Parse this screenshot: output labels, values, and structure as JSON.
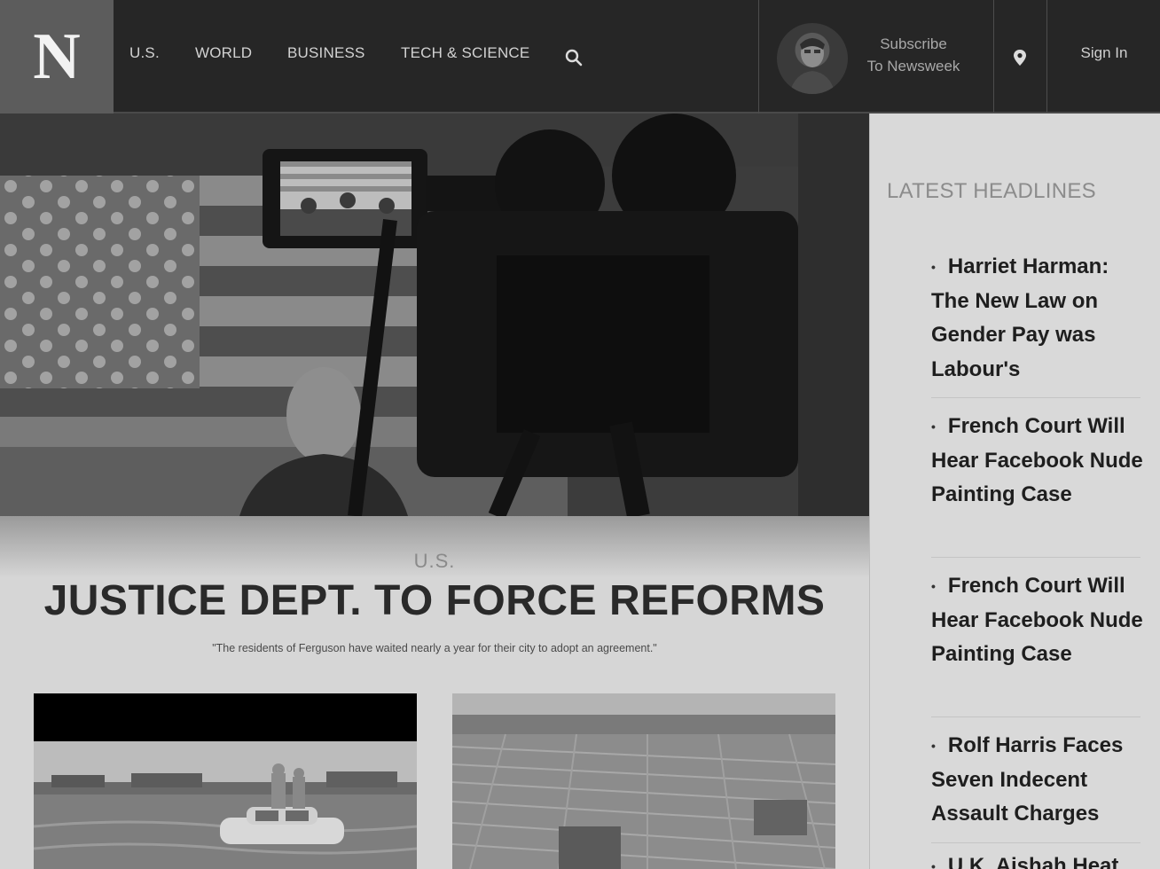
{
  "header": {
    "logo": "N",
    "nav": [
      {
        "label": "U.S."
      },
      {
        "label": "WORLD"
      },
      {
        "label": "BUSINESS"
      },
      {
        "label": "TECH & SCIENCE"
      }
    ],
    "search_icon": "search-icon",
    "subscribe": {
      "line1": "Subscribe",
      "line2": "To Newsweek"
    },
    "location_icon": "map-pin-icon",
    "signin": "Sign In"
  },
  "hero": {
    "section": "U.S.",
    "headline": "JUSTICE DEPT. TO FORCE REFORMS",
    "quote": "\"The residents of Ferguson have waited nearly a year for their city to adopt an agreement.\""
  },
  "sidebar": {
    "title": "LATEST HEADLINES",
    "items": [
      {
        "label": "Harriet Harman: The New Law on Gender Pay was Labour's"
      },
      {
        "label": "French Court Will Hear Facebook Nude Painting Case"
      },
      {
        "label": "French Court Will Hear Facebook Nude Painting Case"
      },
      {
        "label": "Rolf Harris Faces Seven Indecent Assault Charges"
      },
      {
        "label": "U.K. Aishah Heat"
      }
    ]
  }
}
